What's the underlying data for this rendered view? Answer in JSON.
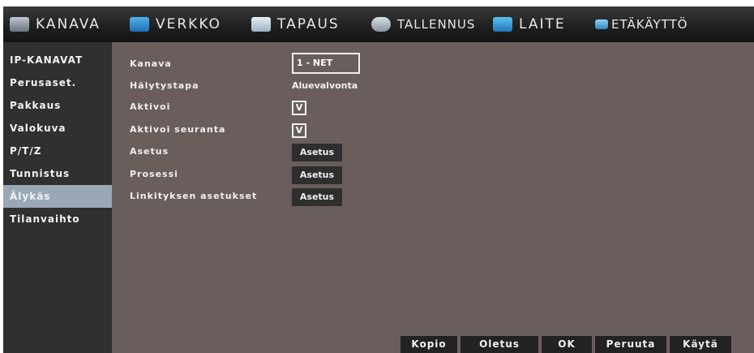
{
  "topbar": {
    "tabs": [
      {
        "label": "KANAVA",
        "icon": "camera-icon"
      },
      {
        "label": "VERKKO",
        "icon": "network-icon"
      },
      {
        "label": "TAPAUS",
        "icon": "event-icon"
      },
      {
        "label": "TALLENNUS",
        "icon": "record-icon"
      },
      {
        "label": "LAITE",
        "icon": "device-icon"
      },
      {
        "label": "ETÄKÄYTTÖ",
        "icon": "remote-icon"
      }
    ]
  },
  "sidebar": {
    "items": [
      {
        "label": "IP-KANAVAT"
      },
      {
        "label": "Perusaset."
      },
      {
        "label": "Pakkaus"
      },
      {
        "label": "Valokuva"
      },
      {
        "label": "P/T/Z"
      },
      {
        "label": "Tunnistus"
      },
      {
        "label": "Älykäs"
      },
      {
        "label": "Tilanvaihto"
      }
    ],
    "active_index": 6
  },
  "form": {
    "channel_label": "Kanava",
    "channel_value": "1 - NET",
    "alarm_type_label": "Hälytystapa",
    "alarm_type_value": "Aluevalvonta",
    "enable_label": "Aktivoi",
    "enable_value": "V",
    "enable_tracking_label": "Aktivoi seuranta",
    "enable_tracking_value": "V",
    "setting_label": "Asetus",
    "setting_button": "Asetus",
    "process_label": "Prosessi",
    "process_button": "Asetus",
    "linkage_label": "Linkityksen asetukset",
    "linkage_button": "Asetus"
  },
  "footer": {
    "copy": "Kopio",
    "default": "Oletus",
    "ok": "OK",
    "cancel": "Peruuta",
    "apply": "Käytä"
  },
  "colors": {
    "background": "#6a5e5c",
    "sidebar": "#303030",
    "sidebar_active": "#9aa8b6",
    "topbar": "#1e1e1e"
  }
}
